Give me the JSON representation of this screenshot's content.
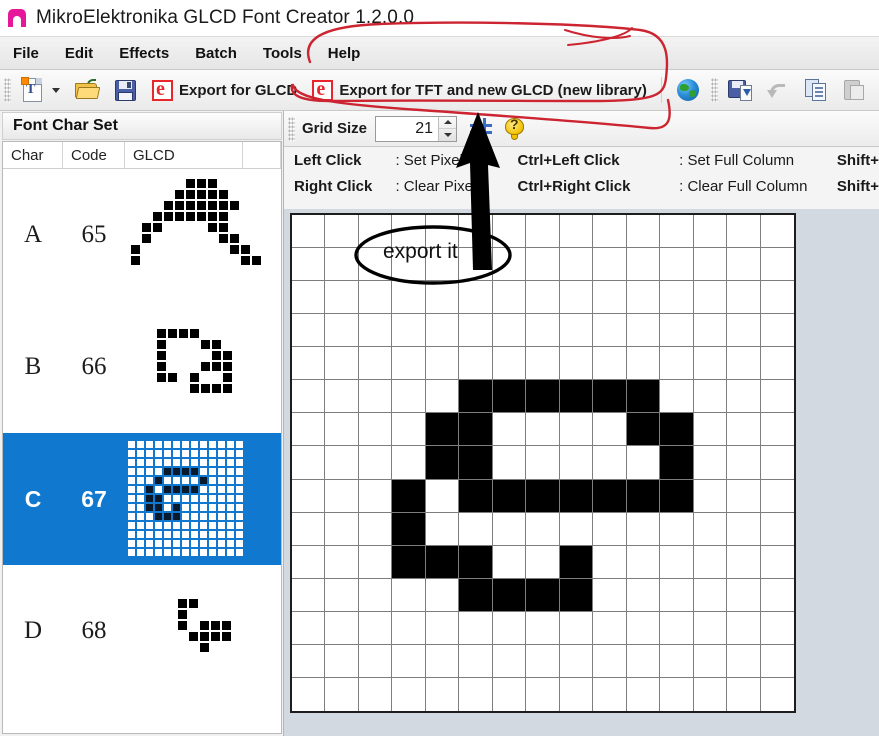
{
  "window": {
    "title": "MikroElektronika GLCD Font Creator 1.2.0.0",
    "icon": "app-logo-icon"
  },
  "menu": {
    "items": [
      {
        "label": "File"
      },
      {
        "label": "Edit"
      },
      {
        "label": "Effects"
      },
      {
        "label": "Batch"
      },
      {
        "label": "Tools"
      },
      {
        "label": "Help"
      }
    ]
  },
  "toolbar_main": {
    "new_font_icon": "new-font-icon",
    "open_icon": "open-folder-icon",
    "save_icon": "save-icon",
    "export_glcd_label": "Export for GLCD",
    "export_glcd_icon": "export-e-icon",
    "export_tft_label": "Export for TFT and new GLCD (new library)",
    "export_tft_icon": "export-e-icon",
    "globe_icon": "globe-icon",
    "save_as_icon": "save-as-icon",
    "undo_icon": "undo-icon",
    "copy_icon": "copy-icon",
    "paste_icon": "paste-icon"
  },
  "toolbar_grid": {
    "grid_size_label": "Grid Size",
    "grid_size_value": "21",
    "grid_toggle_icon": "grid-toggle-icon",
    "help_icon": "help-bulb-icon"
  },
  "left_panel": {
    "header": "Font Char Set",
    "columns": [
      "Char",
      "Code",
      "GLCD"
    ],
    "rows": [
      {
        "char": "A",
        "code": "65",
        "selected": false
      },
      {
        "char": "B",
        "code": "66",
        "selected": false
      },
      {
        "char": "C",
        "code": "67",
        "selected": true
      },
      {
        "char": "D",
        "code": "68",
        "selected": false
      }
    ]
  },
  "instructions": [
    {
      "key": "Left Click",
      "value": ": Set Pixel",
      "key2": "Ctrl+Left Click",
      "value2": ": Set Full Column",
      "key3": "Shift+"
    },
    {
      "key": "Right Click",
      "value": ": Clear Pixel",
      "key2": "Ctrl+Right Click",
      "value2": ": Clear Full Column",
      "key3": "Shift+"
    }
  ],
  "annotations": {
    "callout_text": "export it",
    "highlight_color": "#cc2430",
    "arrow_color": "#000000"
  },
  "colors": {
    "selection_blue": "#1178cf",
    "title_blue_strip": "#1272bb",
    "editor_background": "#d2d9e0",
    "pixel_on": "#000000"
  },
  "pixel_grid": {
    "cols": 15,
    "rows": 15,
    "on_cells": [
      [
        5,
        5
      ],
      [
        5,
        6
      ],
      [
        5,
        7
      ],
      [
        5,
        8
      ],
      [
        5,
        9
      ],
      [
        5,
        10
      ],
      [
        6,
        4
      ],
      [
        6,
        5
      ],
      [
        6,
        10
      ],
      [
        6,
        11
      ],
      [
        7,
        4
      ],
      [
        7,
        5
      ],
      [
        7,
        11
      ],
      [
        8,
        3
      ],
      [
        8,
        5
      ],
      [
        8,
        6
      ],
      [
        8,
        7
      ],
      [
        8,
        8
      ],
      [
        8,
        9
      ],
      [
        8,
        10
      ],
      [
        8,
        11
      ],
      [
        9,
        3
      ],
      [
        10,
        3
      ],
      [
        10,
        4
      ],
      [
        10,
        5
      ],
      [
        10,
        8
      ],
      [
        11,
        5
      ],
      [
        11,
        6
      ],
      [
        11,
        7
      ],
      [
        11,
        8
      ]
    ]
  },
  "glyph_previews": {
    "A": [
      [
        0,
        5
      ],
      [
        0,
        6
      ],
      [
        0,
        7
      ],
      [
        1,
        4
      ],
      [
        1,
        5
      ],
      [
        1,
        6
      ],
      [
        1,
        7
      ],
      [
        1,
        8
      ],
      [
        2,
        3
      ],
      [
        2,
        4
      ],
      [
        2,
        5
      ],
      [
        2,
        6
      ],
      [
        2,
        7
      ],
      [
        2,
        8
      ],
      [
        2,
        9
      ],
      [
        3,
        2
      ],
      [
        3,
        3
      ],
      [
        3,
        4
      ],
      [
        3,
        5
      ],
      [
        3,
        6
      ],
      [
        3,
        7
      ],
      [
        3,
        8
      ],
      [
        4,
        1
      ],
      [
        4,
        2
      ],
      [
        4,
        7
      ],
      [
        4,
        8
      ],
      [
        5,
        1
      ],
      [
        5,
        8
      ],
      [
        5,
        9
      ],
      [
        6,
        0
      ],
      [
        6,
        9
      ],
      [
        6,
        10
      ],
      [
        7,
        0
      ],
      [
        7,
        10
      ],
      [
        7,
        11
      ]
    ],
    "B": [
      [
        0,
        0
      ],
      [
        0,
        1
      ],
      [
        0,
        2
      ],
      [
        0,
        3
      ],
      [
        1,
        0
      ],
      [
        1,
        4
      ],
      [
        1,
        5
      ],
      [
        2,
        0
      ],
      [
        2,
        5
      ],
      [
        2,
        6
      ],
      [
        3,
        0
      ],
      [
        3,
        4
      ],
      [
        3,
        5
      ],
      [
        3,
        6
      ],
      [
        4,
        0
      ],
      [
        4,
        1
      ],
      [
        4,
        3
      ],
      [
        4,
        6
      ],
      [
        5,
        3
      ],
      [
        5,
        4
      ],
      [
        5,
        5
      ],
      [
        5,
        6
      ]
    ],
    "D": [
      [
        0,
        1
      ],
      [
        0,
        2
      ],
      [
        1,
        1
      ],
      [
        2,
        1
      ],
      [
        2,
        3
      ],
      [
        2,
        4
      ],
      [
        2,
        5
      ],
      [
        3,
        2
      ],
      [
        3,
        3
      ],
      [
        3,
        4
      ],
      [
        3,
        5
      ],
      [
        4,
        3
      ]
    ],
    "C_mini": [
      [
        3,
        4
      ],
      [
        3,
        5
      ],
      [
        3,
        6
      ],
      [
        3,
        7
      ],
      [
        4,
        3
      ],
      [
        4,
        8
      ],
      [
        5,
        2
      ],
      [
        5,
        4
      ],
      [
        5,
        5
      ],
      [
        5,
        6
      ],
      [
        5,
        7
      ],
      [
        6,
        2
      ],
      [
        6,
        3
      ],
      [
        7,
        2
      ],
      [
        7,
        3
      ],
      [
        7,
        5
      ],
      [
        8,
        3
      ],
      [
        8,
        4
      ],
      [
        8,
        5
      ]
    ]
  }
}
